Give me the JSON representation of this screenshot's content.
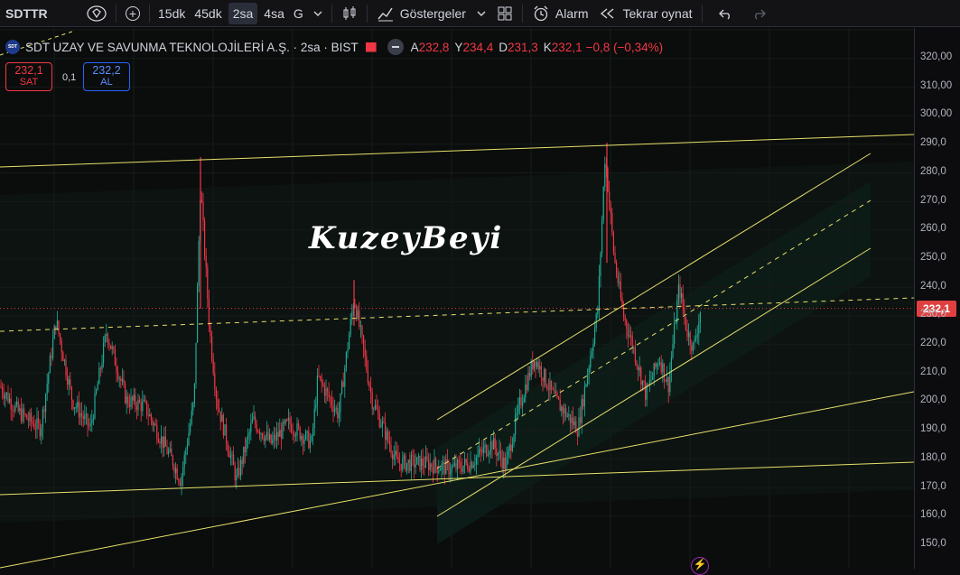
{
  "toolbar": {
    "symbol": "SDTTR",
    "intervals": [
      "15dk",
      "45dk",
      "2sa",
      "4sa",
      "G"
    ],
    "indicators_label": "Göstergeler",
    "alarm_label": "Alarm",
    "replay_label": "Tekrar oynat"
  },
  "legend": {
    "logo_text": "SDT",
    "title": "SDT UZAY VE SAVUNMA TEKNOLOJİLERİ A.Ş. · 2sa · BIST",
    "ohlc": [
      {
        "key": "A",
        "value": "232,8"
      },
      {
        "key": "Y",
        "value": "234,4"
      },
      {
        "key": "D",
        "value": "231,3"
      },
      {
        "key": "K",
        "value": "232,1"
      }
    ],
    "change": "−0,8 (−0,34%)"
  },
  "trade": {
    "sell_price": "232,1",
    "sell_label": "SAT",
    "spread": "0,1",
    "buy_price": "232,2",
    "buy_label": "AL"
  },
  "watermark": "KuzeyBeyi",
  "price_axis": {
    "ticks": [
      "320,00",
      "310,00",
      "300,00",
      "290,0",
      "280,0",
      "270,0",
      "260,0",
      "250,0",
      "240,0",
      "230,0",
      "220,0",
      "210,0",
      "200,0",
      "190,0",
      "180,0",
      "170,0",
      "160,0",
      "150,0"
    ],
    "current_price": "232,1"
  },
  "chart_data": {
    "type": "candlestick",
    "ylim": [
      147,
      326
    ],
    "last_price": 232.1,
    "colors": {
      "up": "#22ab94",
      "down": "#f23645",
      "trendline": "#e8e06a",
      "channel_fill": "#0f2a24",
      "current_price_line": "#f23645"
    }
  }
}
